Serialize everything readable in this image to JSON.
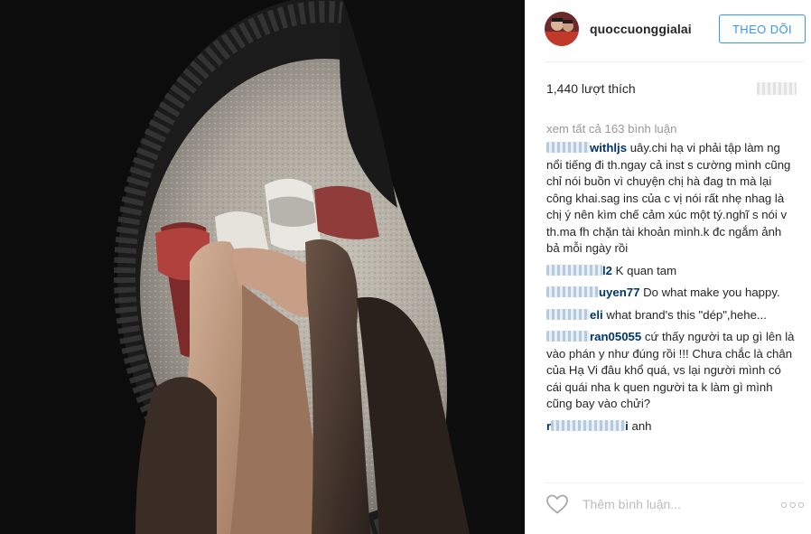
{
  "post": {
    "username": "quoccuonggialai",
    "follow_label": "THEO DÕI",
    "likes": "1,440 lượt thích",
    "view_all_comments": "xem tất cả 163 bình luận"
  },
  "comments": [
    {
      "user_visible": "withljs",
      "text": "uây.chi hạ vi phải tập làm ng nổi tiếng đi th.ngay cả inst s cường mình cũng chỉ nói buồn vì chuyện chị hà đag tn mà lại công khai.sag ins của c vị nói rất nhẹ nhag là chị ý nên kìm chế cảm xúc một tý.nghĩ s nói v th.ma fh chặn tài khoản mình.k đc ngắm ảnh bả mỗi ngày rồi"
    },
    {
      "user_visible": "l2",
      "text": "K quan tam"
    },
    {
      "user_visible": "uyen77",
      "text": "Do what make you happy."
    },
    {
      "user_visible": "eli",
      "text": "what brand's this \"dép\",hehe..."
    },
    {
      "user_visible": "ran05055",
      "text": "cứ thấy người ta up gì lên là vào phán y như đúng rồi !!! Chưa chắc là chân của Hạ Vi đâu khổ quá, vs lại người mình có cái quái nha k quen người ta k làm gì mình cũng bay vào chửi?"
    },
    {
      "user_visible": "r",
      "user_suffix": "i",
      "text": "anh"
    }
  ],
  "footer": {
    "comment_placeholder": "Thêm bình luận...",
    "more_label": "○○○"
  },
  "icons": {
    "heart": "heart-icon",
    "more": "more-options-icon"
  },
  "colors": {
    "accent": "#3897f0",
    "username_link": "#003569",
    "muted": "#999999"
  }
}
